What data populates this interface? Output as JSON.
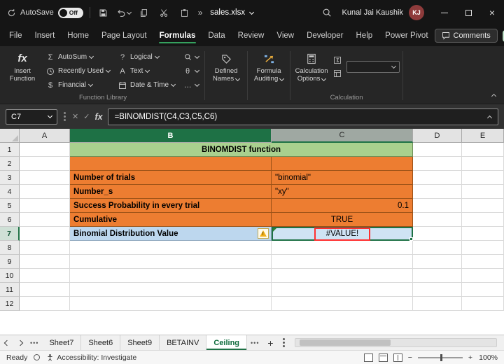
{
  "colors": {
    "excel_green": "#1E7145",
    "tab_underline_green": "#35A15E",
    "orange_fill": "#ED7D31",
    "green_fill": "#A9D08E",
    "blue_fill": "#BDD7EE",
    "annotation_red": "#FF2F2F",
    "avatar_red": "#8E3B3B"
  },
  "icons": {
    "autosum_glyph": "Σ",
    "financial_glyph": "$",
    "logical_glyph": "?",
    "text_glyph": "A",
    "math_glyph": "θ",
    "more_functions_glyph": "…",
    "overflow_glyph": "»",
    "fx_glyph": "fx",
    "cancel_glyph": "✕",
    "check_glyph": "✓",
    "close_glyph": "×",
    "add_sheet_glyph": "+",
    "zoom_out_glyph": "−",
    "zoom_in_glyph": "+",
    "tab_dots": "•••",
    "warning_glyph": "!"
  },
  "titlebar": {
    "autosave_label": "AutoSave",
    "autosave_state": "Off",
    "filename": "sales.xlsx",
    "user_name": "Kunal Jai Kaushik",
    "user_initials": "KJ"
  },
  "tabs": {
    "items": [
      "File",
      "Insert",
      "Home",
      "Page Layout",
      "Formulas",
      "Data",
      "Review",
      "View",
      "Developer",
      "Help",
      "Power Pivot"
    ],
    "active": "Formulas",
    "comments_label": "Comments"
  },
  "ribbon": {
    "insert_function_label": "Insert Function",
    "autosum_label": "AutoSum",
    "recently_used_label": "Recently Used",
    "financial_label": "Financial",
    "logical_label": "Logical",
    "text_label": "Text",
    "date_time_label": "Date & Time",
    "defined_names_label": "Defined Names",
    "formula_auditing_label": "Formula Auditing",
    "calculation_options_label": "Calculation Options",
    "function_library_group": "Function Library",
    "calculation_group": "Calculation"
  },
  "formula_bar": {
    "name_box": "C7",
    "formula": "=BINOMDIST(C4,C3,C5,C6)"
  },
  "grid": {
    "col_headers": [
      "A",
      "B",
      "C",
      "D",
      "E"
    ],
    "row_numbers": [
      "1",
      "2",
      "3",
      "4",
      "5",
      "6",
      "7",
      "8",
      "9",
      "10",
      "11",
      "12"
    ],
    "title_row": "BINOMDIST function",
    "labels": {
      "trials": "Number of trials",
      "number_s": "Number_s",
      "probability": "Success Probability in every trial",
      "cumulative": "Cumulative",
      "result": "Binomial Distribution Value"
    },
    "values": {
      "trials": "\"binomial\"",
      "number_s": "\"xy\"",
      "probability": "0.1",
      "cumulative": "TRUE",
      "result": "#VALUE!"
    }
  },
  "sheet_tabs": {
    "items": [
      "Sheet7",
      "Sheet6",
      "Sheet9",
      "BETAINV",
      "Ceiling"
    ],
    "active": "Ceiling"
  },
  "status_bar": {
    "ready": "Ready",
    "accessibility": "Accessibility: Investigate",
    "zoom": "100%"
  }
}
